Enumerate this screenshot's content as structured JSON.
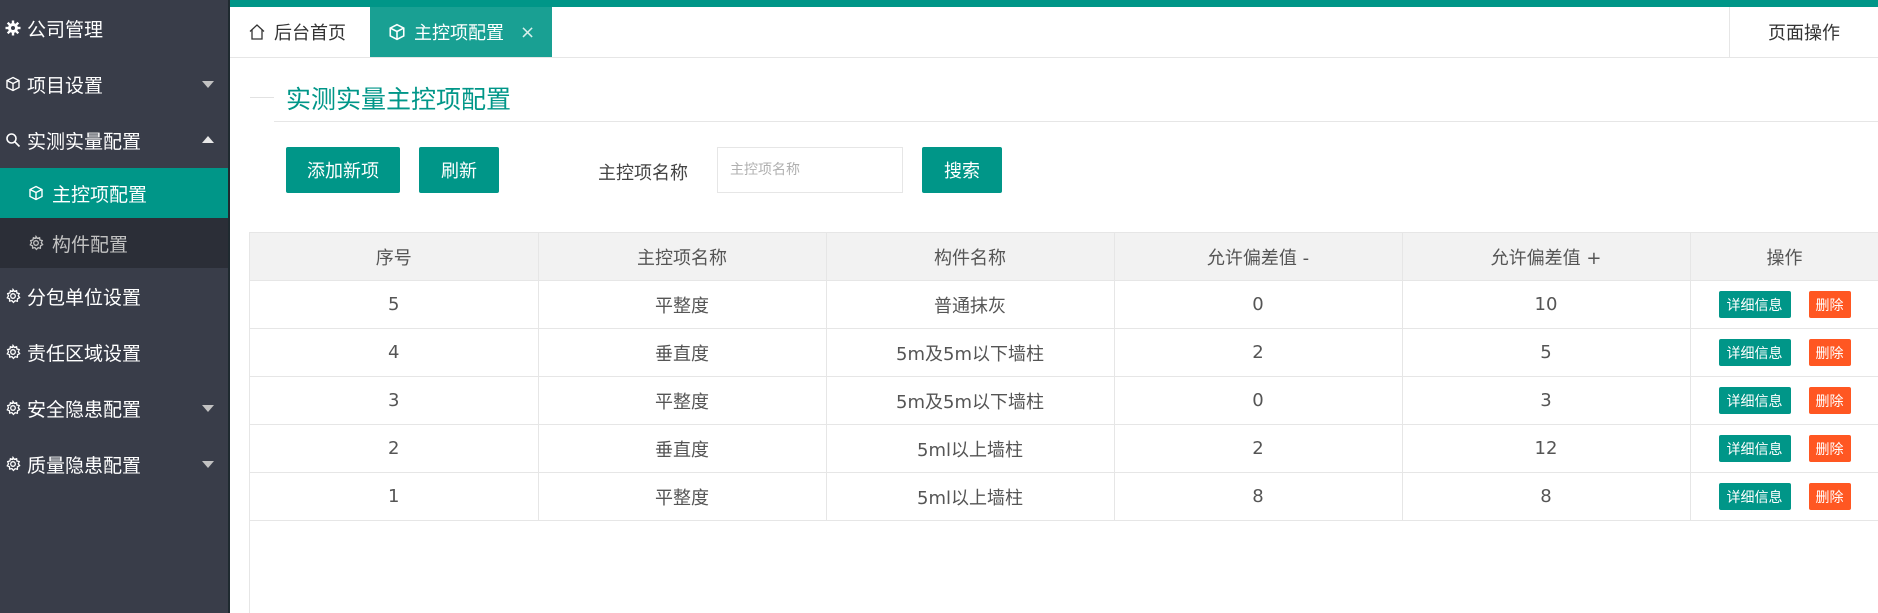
{
  "sidebar": {
    "items": [
      {
        "label": "公司管理",
        "icon": "gear-icon"
      },
      {
        "label": "项目设置",
        "icon": "cube-icon",
        "caret": "down"
      },
      {
        "label": "实测实量配置",
        "icon": "search-icon",
        "caret": "up"
      },
      {
        "label": "分包单位设置",
        "icon": "gear-icon"
      },
      {
        "label": "责任区域设置",
        "icon": "gear-icon"
      },
      {
        "label": "安全隐患配置",
        "icon": "gear-icon",
        "caret": "down"
      },
      {
        "label": "质量隐患配置",
        "icon": "gear-icon",
        "caret": "down"
      }
    ],
    "sub_items": [
      {
        "label": "主控项配置",
        "icon": "cube-icon",
        "active": true
      },
      {
        "label": "构件配置",
        "icon": "gear-icon",
        "active": false
      }
    ]
  },
  "tabs": {
    "home": {
      "label": "后台首页",
      "icon": "home-icon"
    },
    "active": {
      "label": "主控项配置",
      "icon": "cube-icon",
      "close": "×"
    },
    "page_ops": "页面操作"
  },
  "content": {
    "title": "实测实量主控项配置",
    "add_label": "添加新项",
    "refresh_label": "刷新",
    "search_label": "主控项名称",
    "search_placeholder": "主控项名称",
    "search_value": "",
    "search_button": "搜索"
  },
  "table": {
    "headers": [
      "序号",
      "主控项名称",
      "构件名称",
      "允许偏差值 -",
      "允许偏差值 +",
      "操作"
    ],
    "rows": [
      [
        "5",
        "平整度",
        "普通抹灰",
        "0",
        "10"
      ],
      [
        "4",
        "垂直度",
        "5m及5m以下墙柱",
        "2",
        "5"
      ],
      [
        "3",
        "平整度",
        "5m及5m以下墙柱",
        "0",
        "3"
      ],
      [
        "2",
        "垂直度",
        "5ml以上墙柱",
        "2",
        "12"
      ],
      [
        "1",
        "平整度",
        "5ml以上墙柱",
        "8",
        "8"
      ]
    ],
    "detail_label": "详细信息",
    "delete_label": "删除"
  },
  "colors": {
    "accent": "#009688",
    "sidebar_bg": "#393D49",
    "danger": "#FF5722"
  }
}
